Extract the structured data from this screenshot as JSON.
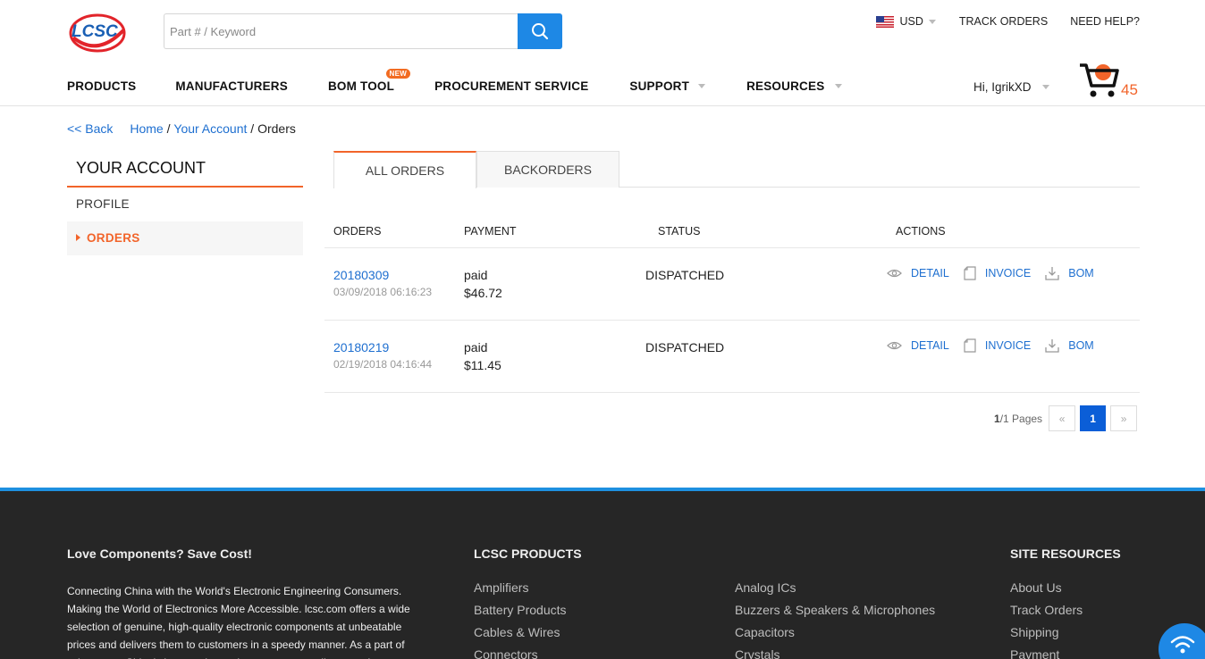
{
  "logo": {
    "text": "LCSC"
  },
  "search": {
    "placeholder": "Part # / Keyword"
  },
  "topbar": {
    "currency": "USD",
    "track_orders": "TRACK ORDERS",
    "need_help": "NEED HELP?"
  },
  "nav": {
    "products": "PRODUCTS",
    "manufacturers": "MANUFACTURERS",
    "bom_tool": "BOM TOOL",
    "bom_badge": "NEW",
    "procurement": "PROCUREMENT SERVICE",
    "support": "SUPPORT",
    "resources": "RESOURCES"
  },
  "user": {
    "greeting": "Hi, IgrikXD"
  },
  "cart": {
    "count": "45"
  },
  "breadcrumb": {
    "back": "<< Back",
    "home": "Home",
    "sep1": " / ",
    "account": "Your Account",
    "sep2": " / ",
    "current": "Orders"
  },
  "sidebar": {
    "title": "YOUR ACCOUNT",
    "items": [
      "PROFILE",
      "ORDERS"
    ]
  },
  "tabs": {
    "all_orders": "ALL ORDERS",
    "backorders": "BACKORDERS"
  },
  "table": {
    "headers": {
      "orders": "ORDERS",
      "payment": "PAYMENT",
      "status": "STATUS",
      "actions": "ACTIONS"
    },
    "rows": [
      {
        "order_no": "20180309",
        "date": "03/09/2018 06:16:23",
        "payment_status": "paid",
        "amount": "$46.72",
        "status": "DISPATCHED"
      },
      {
        "order_no": "20180219",
        "date": "02/19/2018 04:16:44",
        "payment_status": "paid",
        "amount": "$11.45",
        "status": "DISPATCHED"
      }
    ],
    "actions": {
      "detail": "DETAIL",
      "invoice": "INVOICE",
      "bom": "BOM"
    }
  },
  "pagination": {
    "current": "1",
    "total_text": "/1 Pages",
    "prev": "«",
    "next": "»",
    "page_button": "1"
  },
  "footer": {
    "col1_title": "Love Components? Save Cost!",
    "col1_text": "Connecting China with the World's Electronic Engineering Consumers. Making the World of Electronics More Accessible. lcsc.com offers a wide selection of genuine, high-quality electronic components at unbeatable prices and delivers them to customers in a speedy manner. As a part of szlcsc.com, China's largest electronic components online store by",
    "col2_title": "LCSC PRODUCTS",
    "products_a": [
      "Amplifiers",
      "Battery Products",
      "Cables & Wires",
      "Connectors"
    ],
    "products_b": [
      "Analog ICs",
      "Buzzers & Speakers & Microphones",
      "Capacitors",
      "Crystals"
    ],
    "col3_title": "SITE RESOURCES",
    "resources": [
      "About Us",
      "Track Orders",
      "Shipping",
      "Payment"
    ]
  },
  "colors": {
    "accent": "#f2642a",
    "link": "#1e6fd0",
    "primary": "#1e88e5",
    "footer_bg": "#262626"
  }
}
